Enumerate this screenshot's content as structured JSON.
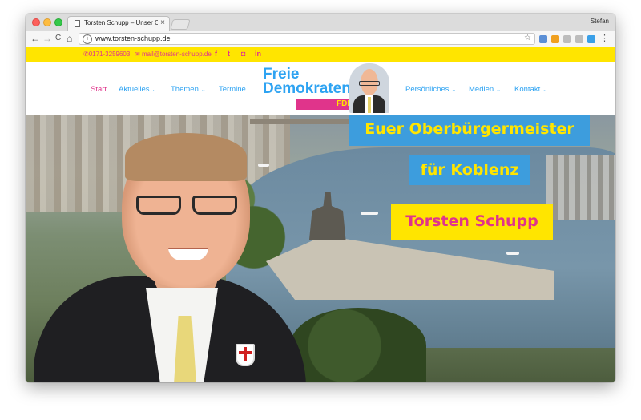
{
  "browser": {
    "tab_title": "Torsten Schupp – Unser Obert",
    "tab_close": "×",
    "user_name": "Stefan",
    "url": "www.torsten-schupp.de",
    "info_glyph": "i",
    "star_glyph": "☆",
    "menu_glyph": "⋮",
    "nav": {
      "back": "←",
      "forward": "→",
      "reload": "C",
      "home": "⌂"
    },
    "extension_colors": [
      "#5b8fd6",
      "#f0a020",
      "#bdbdbd",
      "#bdbdbd",
      "#3aa0e8"
    ]
  },
  "contact": {
    "phone_icon": "phone-icon",
    "phone": "0171-3259603",
    "mail_icon": "mail-icon",
    "email": "mail@torsten-schupp.de",
    "social": [
      {
        "name": "facebook-icon",
        "glyph": "f"
      },
      {
        "name": "twitter-icon",
        "glyph": "t"
      },
      {
        "name": "instagram-icon",
        "glyph": "◘"
      },
      {
        "name": "linkedin-icon",
        "glyph": "in"
      }
    ]
  },
  "nav": {
    "items_left": [
      {
        "label": "Start",
        "active": true
      },
      {
        "label": "Aktuelles",
        "dropdown": true
      },
      {
        "label": "Themen",
        "dropdown": true
      },
      {
        "label": "Termine",
        "dropdown": false
      }
    ],
    "items_right": [
      {
        "label": "Persönliches",
        "dropdown": true
      },
      {
        "label": "Medien",
        "dropdown": true
      },
      {
        "label": "Kontakt",
        "dropdown": true
      }
    ],
    "chevron": "⌄"
  },
  "logo": {
    "line1": "Freie",
    "line2": "Demokraten",
    "party": "FDP"
  },
  "hero": {
    "headline1": "Euer Oberbürgermeister",
    "headline2": "für Koblenz",
    "name": "Torsten Schupp",
    "slide_count": 3,
    "active_slide": 1
  },
  "colors": {
    "accent_blue": "#2ea3f2",
    "accent_pink": "#e0348b",
    "accent_yellow": "#ffe500",
    "box_blue": "#3d9ddd"
  }
}
